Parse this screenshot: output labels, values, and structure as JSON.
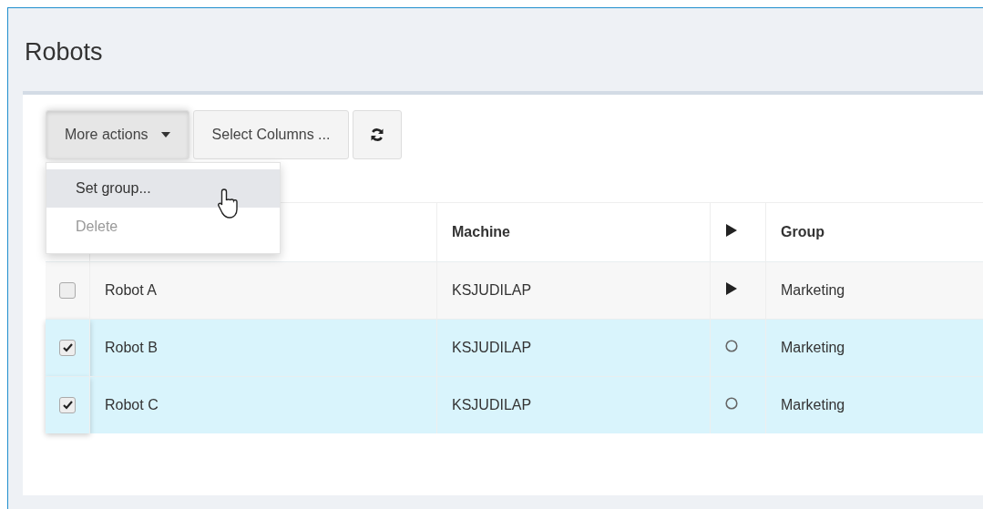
{
  "page": {
    "title": "Robots"
  },
  "toolbar": {
    "buttons": [
      {
        "kind": "dropdown",
        "label": "More actions",
        "pressed": true
      },
      {
        "kind": "text",
        "label": "Select Columns ..."
      },
      {
        "kind": "refresh"
      }
    ]
  },
  "menu": {
    "items": [
      {
        "label": "Set group...",
        "highlighted": true,
        "disabled": false
      },
      {
        "label": "Delete",
        "highlighted": false,
        "disabled": true
      }
    ]
  },
  "table": {
    "columns": [
      {
        "kind": "check"
      },
      {
        "kind": "text"
      },
      {
        "kind": "text",
        "label": "Machine"
      },
      {
        "kind": "play"
      },
      {
        "kind": "text",
        "label": "Group"
      }
    ],
    "rows": [
      {
        "name": "Robot A",
        "machine": "KSJUDILAP",
        "kind": "play",
        "group": "Marketing",
        "selected": false
      },
      {
        "name": "Robot B",
        "machine": "KSJUDILAP",
        "kind": "circle",
        "group": "Marketing",
        "selected": true
      },
      {
        "name": "Robot C",
        "machine": "KSJUDILAP",
        "kind": "circle",
        "group": "Marketing",
        "selected": true
      }
    ]
  }
}
